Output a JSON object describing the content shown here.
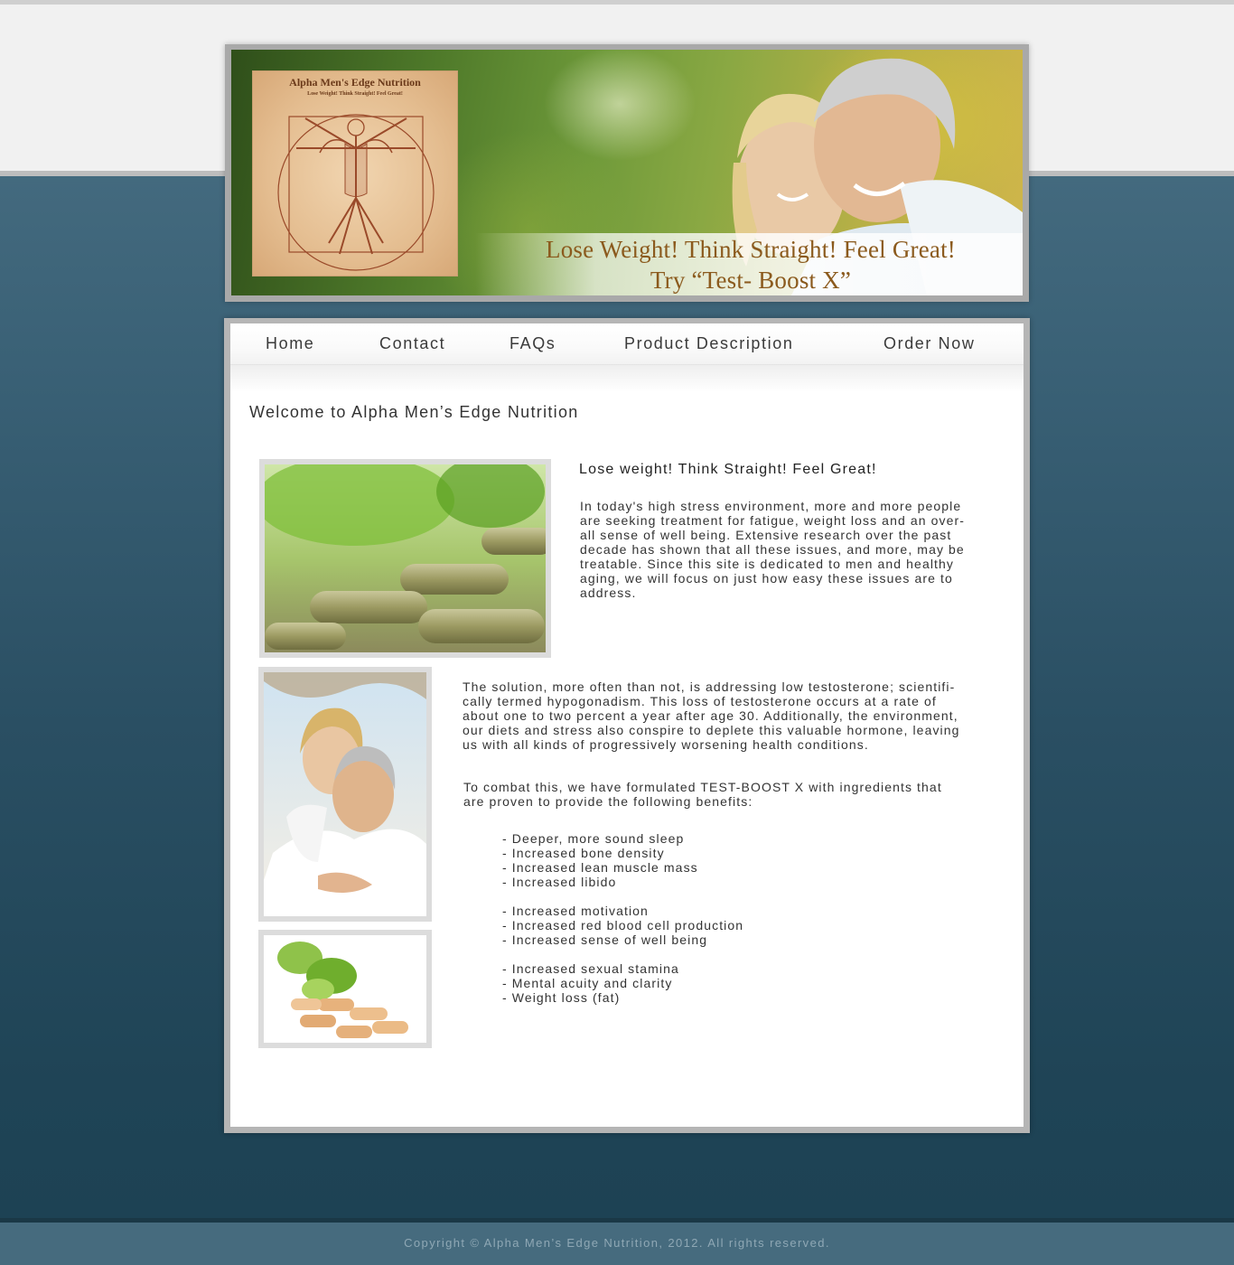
{
  "header": {
    "logo_title": "Alpha Men's Edge Nutrition",
    "logo_subtitle": "Lose Weight! Think Straight! Feel Great!",
    "tagline_line1": "Lose Weight! Think Straight! Feel Great!",
    "tagline_line2": "Try “Test- Boost X”"
  },
  "nav": {
    "items": [
      {
        "label": "Home"
      },
      {
        "label": "Contact"
      },
      {
        "label": "FAQs"
      },
      {
        "label": "Product Description"
      },
      {
        "label": "Order Now"
      }
    ]
  },
  "main": {
    "welcome": "Welcome to Alpha Men’s Edge Nutrition",
    "subheading": "Lose weight! Think Straight! Feel Great!",
    "intro_lines": [
      "In today's high stress environment, more and more people",
      "are seeking treatment for fatigue, weight loss and an over-",
      "all sense of well being. Extensive research over the past",
      "decade has shown that all these issues, and more, may be",
      "treatable. Since this site is dedicated to men and healthy",
      "aging, we will focus on just how easy these issues are to",
      "address."
    ],
    "solution_lines": [
      "The solution, more often than not, is addressing low testosterone; scientifi-",
      "cally termed hypogonadism. This loss of testosterone occurs at a rate of",
      "about one to two percent a year after age 30. Additionally, the environment,",
      "our diets and stress also conspire to deplete this valuable hormone, leaving",
      "us with all kinds of progressively worsening health conditions."
    ],
    "combat_lines": [
      "To combat this, we have formulated TEST-BOOST X with ingredients that",
      "are proven to provide the following benefits:"
    ],
    "benefits": [
      [
        "- Deeper, more sound sleep",
        "- Increased bone density",
        "- Increased lean muscle mass",
        "- Increased libido"
      ],
      [
        "- Increased motivation",
        "- Increased red blood cell production",
        "- Increased sense of well being"
      ],
      [
        "- Increased sexual stamina",
        "- Mental acuity and clarity",
        "- Weight loss (fat)"
      ]
    ]
  },
  "footer": {
    "copyright": "Copyright © Alpha Men’s Edge Nutrition, 2012. All rights reserved."
  }
}
